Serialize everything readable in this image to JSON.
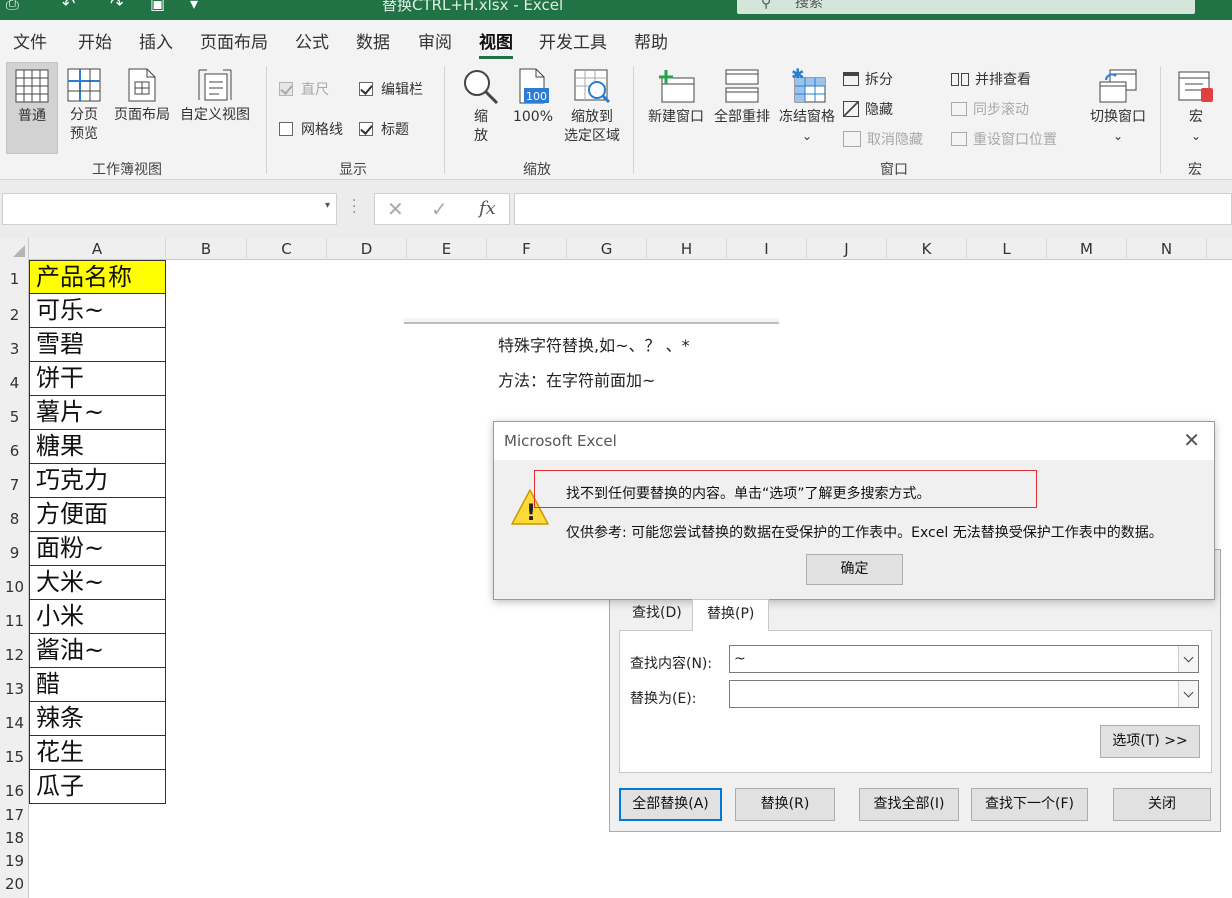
{
  "titlebar": {
    "title": "替换CTRL+H.xlsx - Excel",
    "search_placeholder": "搜索"
  },
  "tabs": [
    {
      "label": "文件"
    },
    {
      "label": "开始"
    },
    {
      "label": "插入"
    },
    {
      "label": "页面布局"
    },
    {
      "label": "公式"
    },
    {
      "label": "数据"
    },
    {
      "label": "审阅"
    },
    {
      "label": "视图"
    },
    {
      "label": "开发工具"
    },
    {
      "label": "帮助"
    }
  ],
  "active_tab": "视图",
  "accent_color": "#217346",
  "ribbon": {
    "workbook_views": {
      "group_label": "工作簿视图",
      "normal": "普通",
      "page_break_l1": "分页",
      "page_break_l2": "预览",
      "page_layout": "页面布局",
      "custom_views": "自定义视图"
    },
    "show": {
      "group_label": "显示",
      "ruler": "直尺",
      "formula_bar": "编辑栏",
      "gridlines": "网格线",
      "headings": "标题"
    },
    "zoom": {
      "group_label": "缩放",
      "zoom_l1": "缩",
      "zoom_l2": "放",
      "hundred": "100%",
      "zoom_sel_l1": "缩放到",
      "zoom_sel_l2": "选定区域",
      "icon_text": "100"
    },
    "window": {
      "group_label": "窗口",
      "new_window": "新建窗口",
      "arrange_all": "全部重排",
      "freeze_panes": "冻结窗格",
      "split": "拆分",
      "hide": "隐藏",
      "unhide": "取消隐藏",
      "side_by_side": "并排查看",
      "sync_scroll": "同步滚动",
      "reset_position": "重设窗口位置",
      "switch_windows": "切换窗口"
    },
    "macros": {
      "group_label": "宏",
      "macros": "宏"
    }
  },
  "formula_bar": {
    "cancel_glyph": "✕",
    "enter_glyph": "✓",
    "fx_label": "fx"
  },
  "columns": [
    "A",
    "B",
    "C",
    "D",
    "E",
    "F",
    "G",
    "H",
    "I",
    "J",
    "K",
    "L",
    "M",
    "N"
  ],
  "rows": [
    "1",
    "2",
    "3",
    "4",
    "5",
    "6",
    "7",
    "8",
    "9",
    "10",
    "11",
    "12",
    "13",
    "14",
    "15",
    "16",
    "17",
    "18",
    "19",
    "20"
  ],
  "column_a": [
    "产品名称",
    "可乐~",
    "雪碧",
    "饼干",
    "薯片~",
    "糖果",
    "巧克力",
    "方便面",
    "面粉~",
    "大米~",
    "小米",
    "酱油~",
    "醋",
    "辣条",
    "花生",
    "瓜子"
  ],
  "header_fill_color": "#ffff00",
  "notes": {
    "line1": "特殊字符替换,如~、？ 、*",
    "line2": "方法：在字符前面加~"
  },
  "find_replace": {
    "tab_find": "查找(D)",
    "tab_replace": "替换(P)",
    "find_label": "查找内容(N):",
    "find_value": "~",
    "replace_label": "替换为(E):",
    "replace_value": "",
    "options_btn": "选项(T) >>",
    "replace_all_btn": "全部替换(A)",
    "replace_btn": "替换(R)",
    "find_all_btn": "查找全部(I)",
    "find_next_btn": "查找下一个(F)",
    "close_btn": "关闭"
  },
  "alert": {
    "title": "Microsoft Excel",
    "close_glyph": "✕",
    "message1": "找不到任何要替换的内容。单击“选项”了解更多搜索方式。",
    "message2": "仅供参考: 可能您尝试替换的数据在受保护的工作表中。Excel 无法替换受保护工作表中的数据。",
    "ok_btn": "确定",
    "warning_glyph": "!"
  }
}
